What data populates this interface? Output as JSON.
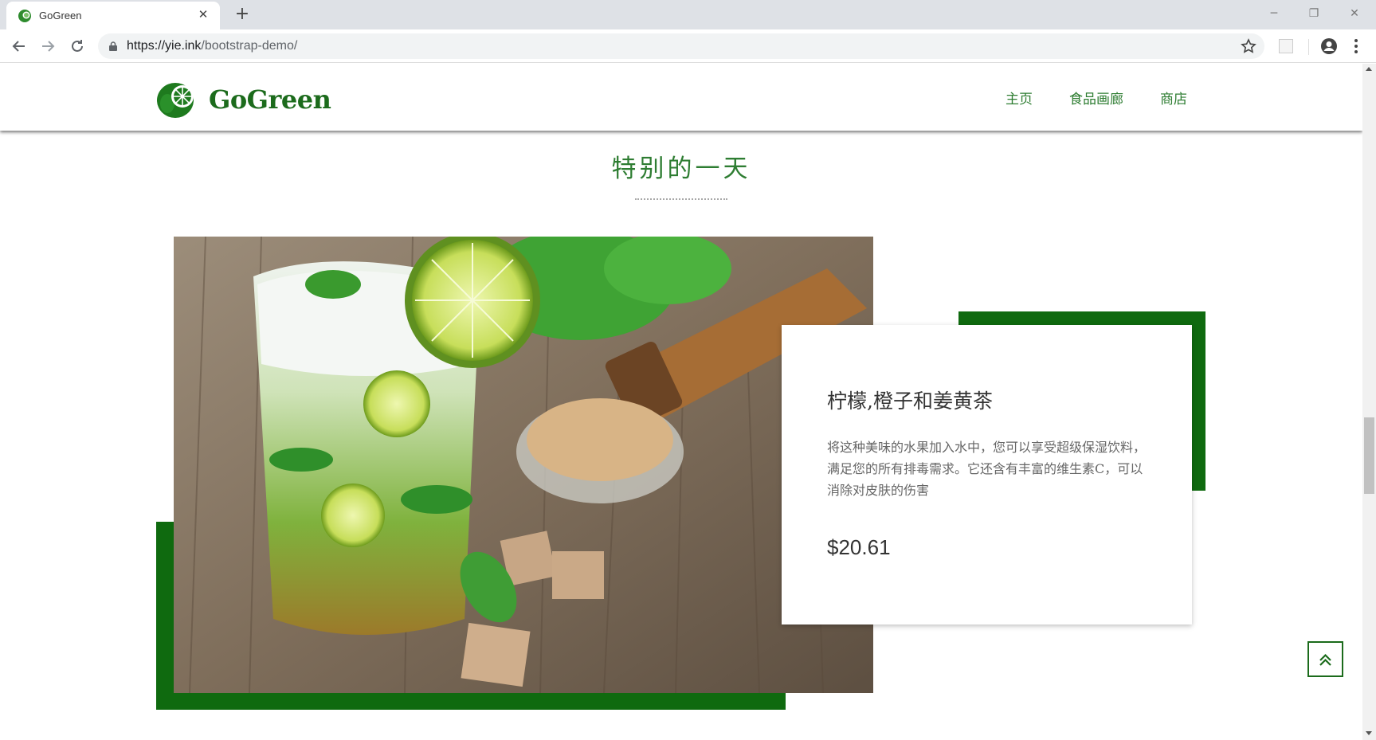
{
  "browser": {
    "tab_title": "GoGreen",
    "url_host": "https://yie.ink",
    "url_path": "/bootstrap-demo/",
    "icons": [
      "back-icon",
      "forward-icon",
      "reload-icon",
      "lock-icon",
      "star-icon",
      "profile-icon",
      "menu-icon"
    ]
  },
  "header": {
    "logo_text": "GoGreen",
    "nav": [
      "主页",
      "食品画廊",
      "商店"
    ]
  },
  "section": {
    "title": "特别的一天"
  },
  "product": {
    "name": "柠檬,橙子和姜黄茶",
    "description": "将这种美味的水果加入水中，您可以享受超级保湿饮料，满足您的所有排毒需求。它还含有丰富的维生素C，可以消除对皮肤的伤害",
    "price": "$20.61"
  },
  "colors": {
    "brand_green": "#0f6a0f",
    "nav_green": "#2e7d32"
  }
}
